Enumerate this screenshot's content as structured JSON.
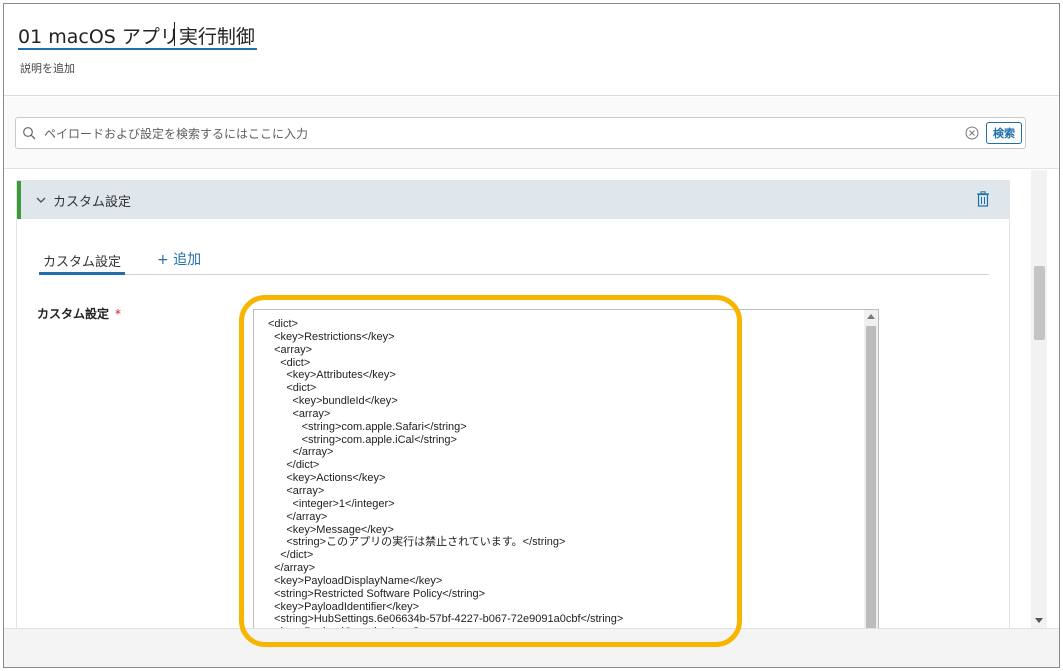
{
  "header": {
    "title": "01 macOS アプリ実行制御",
    "description_link": "説明を追加"
  },
  "search": {
    "placeholder": "ペイロードおよび設定を検索するにはここに入力",
    "button_label": "検索"
  },
  "section": {
    "title": "カスタム設定",
    "tabs": [
      {
        "label": "カスタム設定",
        "active": true
      },
      {
        "label": "+ 追加",
        "active": false
      }
    ],
    "field_label": "カスタム設定",
    "required_mark": "*",
    "editor_content": "<dict>\n  <key>Restrictions</key>\n  <array>\n    <dict>\n      <key>Attributes</key>\n      <dict>\n        <key>bundleId</key>\n        <array>\n           <string>com.apple.Safari</string>\n           <string>com.apple.iCal</string>\n        </array>\n      </dict>\n      <key>Actions</key>\n      <array>\n        <integer>1</integer>\n      </array>\n      <key>Message</key>\n      <string>このアプリの実行は禁止されています。</string>\n    </dict>\n  </array>\n  <key>PayloadDisplayName</key>\n  <string>Restricted Software Policy</string>\n  <key>PayloadIdentifier</key>\n  <string>HubSettings.6e06634b-57bf-4227-b067-72e9091a0cbf</string>\n  <key>PayloadOrganization</key>"
  },
  "colors": {
    "accent": "#1f6fa8",
    "section_header_bg": "#dfe7ed",
    "section_indicator": "#3d9a3b",
    "highlight": "#f7b500",
    "required": "#cc2222"
  },
  "icons": {
    "search": "search-icon",
    "clear": "clear-circle-x-icon",
    "chevron": "chevron-down-icon",
    "delete": "trash-icon"
  }
}
